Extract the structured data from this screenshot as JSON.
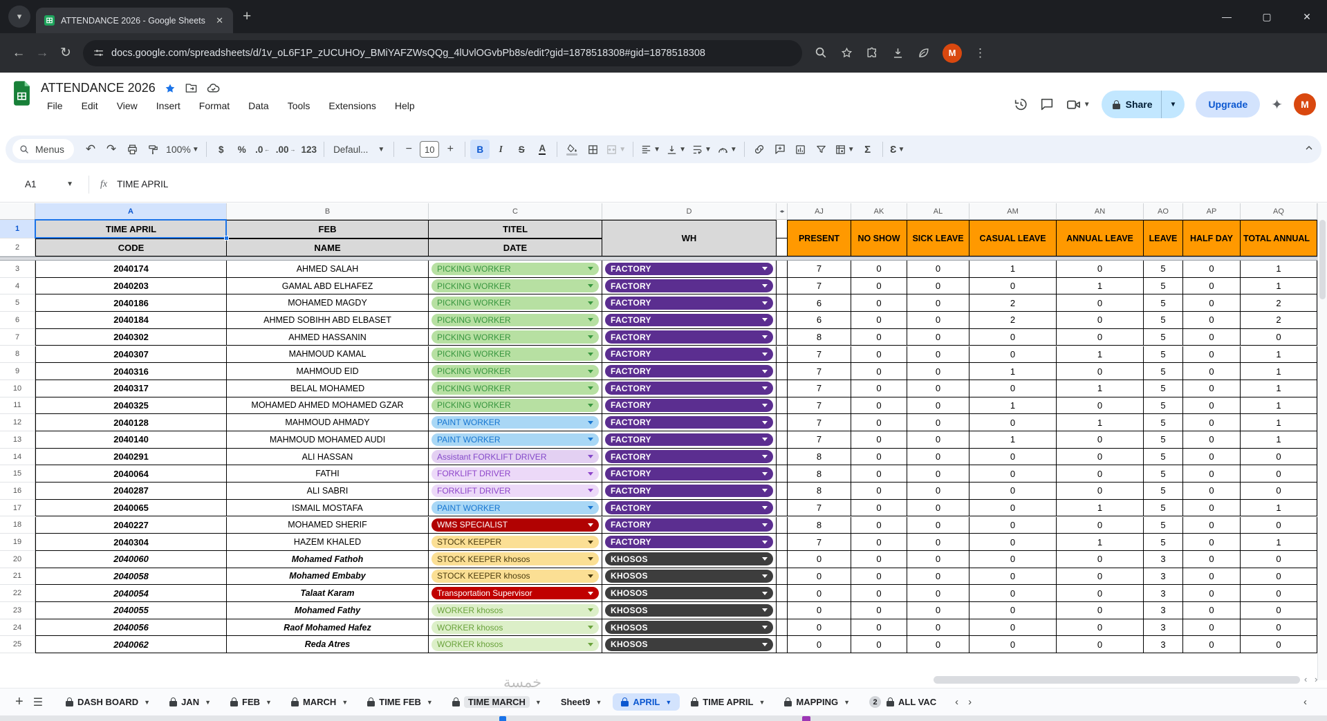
{
  "browser": {
    "tab_title": "ATTENDANCE 2026 - Google Sheets",
    "url": "docs.google.com/spreadsheets/d/1v_oL6F1P_zUCUHOy_BMiYAFZWsQQg_4lUvlOGvbPb8s/edit?gid=1878518308#gid=1878518308"
  },
  "header": {
    "title": "ATTENDANCE 2026",
    "menus": [
      "File",
      "Edit",
      "View",
      "Insert",
      "Format",
      "Data",
      "Tools",
      "Extensions",
      "Help"
    ],
    "share_label": "Share",
    "upgrade_label": "Upgrade",
    "avatar_letter": "M"
  },
  "toolbar": {
    "menus_label": "Menus",
    "zoom": "100%",
    "format_labels": [
      "$",
      "%",
      ".0",
      ".00",
      "123"
    ],
    "font_name": "Defaul...",
    "font_size": "10",
    "bold": "B",
    "italic": "I",
    "strike": "S",
    "textcolor": "A",
    "sigma": "Σ",
    "epsilon": "Ɛ"
  },
  "formula_bar": {
    "cell_ref": "A1",
    "fx_label": "fx",
    "formula": "TIME APRIL"
  },
  "grid": {
    "column_letters": [
      "A",
      "B",
      "C",
      "D",
      "AJ",
      "AK",
      "AL",
      "AM",
      "AN",
      "AO",
      "AP",
      "AQ"
    ],
    "row1": {
      "a": "TIME APRIL",
      "b": "FEB",
      "c": "TITEL",
      "d": "WH"
    },
    "row2": {
      "a": "CODE",
      "b": "NAME",
      "c": "DATE"
    },
    "right_headers": [
      "PRESENT",
      "NO SHOW",
      "SICK LEAVE",
      "CASUAL LEAVE",
      "ANNUAL LEAVE",
      "LEAVE",
      "HALF DAY",
      "TOTAL ANNUAL"
    ],
    "pill_styles": {
      "picking": {
        "bg": "#b7e0a2",
        "fg": "#38963f"
      },
      "paint": {
        "bg": "#a9d7f5",
        "fg": "#1776d1"
      },
      "asst_forklift": {
        "bg": "#e3d0f2",
        "fg": "#8449c9"
      },
      "forklift": {
        "bg": "#ecd9f8",
        "fg": "#8d44c9"
      },
      "wms": {
        "bg": "#b10202",
        "fg": "#ffffff"
      },
      "stock": {
        "bg": "#fbdf94",
        "fg": "#4a3b0e"
      },
      "transport": {
        "bg": "#c00000",
        "fg": "#ffffff"
      },
      "worker": {
        "bg": "#dcefc8",
        "fg": "#6aa23c"
      },
      "factory": {
        "bg": "#5b2e90",
        "fg": "#ffffff"
      },
      "khosos": {
        "bg": "#3d3d3d",
        "fg": "#ffffff"
      }
    },
    "rows": [
      {
        "n": 3,
        "code": "2040174",
        "name": "AHMED SALAH",
        "title": "PICKING WORKER",
        "title_style": "picking",
        "dept": "FACTORY",
        "dept_style": "factory",
        "values": [
          7,
          0,
          0,
          1,
          0,
          5,
          0,
          1
        ],
        "em": false
      },
      {
        "n": 4,
        "code": "2040203",
        "name": "GAMAL ABD ELHAFEZ",
        "title": "PICKING WORKER",
        "title_style": "picking",
        "dept": "FACTORY",
        "dept_style": "factory",
        "values": [
          7,
          0,
          0,
          0,
          1,
          5,
          0,
          1
        ],
        "em": false
      },
      {
        "n": 5,
        "code": "2040186",
        "name": "MOHAMED MAGDY",
        "title": "PICKING WORKER",
        "title_style": "picking",
        "dept": "FACTORY",
        "dept_style": "factory",
        "values": [
          6,
          0,
          0,
          2,
          0,
          5,
          0,
          2
        ],
        "em": false
      },
      {
        "n": 6,
        "code": "2040184",
        "name": "AHMED SOBIHH ABD ELBASET",
        "title": "PICKING WORKER",
        "title_style": "picking",
        "dept": "FACTORY",
        "dept_style": "factory",
        "values": [
          6,
          0,
          0,
          2,
          0,
          5,
          0,
          2
        ],
        "em": false
      },
      {
        "n": 7,
        "code": "2040302",
        "name": "AHMED HASSANIN",
        "title": "PICKING WORKER",
        "title_style": "picking",
        "dept": "FACTORY",
        "dept_style": "factory",
        "values": [
          8,
          0,
          0,
          0,
          0,
          5,
          0,
          0
        ],
        "em": false
      },
      {
        "n": 8,
        "code": "2040307",
        "name": "MAHMOUD KAMAL",
        "title": "PICKING WORKER",
        "title_style": "picking",
        "dept": "FACTORY",
        "dept_style": "factory",
        "values": [
          7,
          0,
          0,
          0,
          1,
          5,
          0,
          1
        ],
        "em": false
      },
      {
        "n": 9,
        "code": "2040316",
        "name": "MAHMOUD EID",
        "title": "PICKING WORKER",
        "title_style": "picking",
        "dept": "FACTORY",
        "dept_style": "factory",
        "values": [
          7,
          0,
          0,
          1,
          0,
          5,
          0,
          1
        ],
        "em": false
      },
      {
        "n": 10,
        "code": "2040317",
        "name": "BELAL MOHAMED",
        "title": "PICKING WORKER",
        "title_style": "picking",
        "dept": "FACTORY",
        "dept_style": "factory",
        "values": [
          7,
          0,
          0,
          0,
          1,
          5,
          0,
          1
        ],
        "em": false
      },
      {
        "n": 11,
        "code": "2040325",
        "name": "MOHAMED AHMED MOHAMED GZAR",
        "title": "PICKING WORKER",
        "title_style": "picking",
        "dept": "FACTORY",
        "dept_style": "factory",
        "values": [
          7,
          0,
          0,
          1,
          0,
          5,
          0,
          1
        ],
        "em": false
      },
      {
        "n": 12,
        "code": "2040128",
        "name": "MAHMOUD AHMADY",
        "title": "PAINT WORKER",
        "title_style": "paint",
        "dept": "FACTORY",
        "dept_style": "factory",
        "values": [
          7,
          0,
          0,
          0,
          1,
          5,
          0,
          1
        ],
        "em": false
      },
      {
        "n": 13,
        "code": "2040140",
        "name": "MAHMOUD MOHAMED AUDI",
        "title": "PAINT WORKER",
        "title_style": "paint",
        "dept": "FACTORY",
        "dept_style": "factory",
        "values": [
          7,
          0,
          0,
          1,
          0,
          5,
          0,
          1
        ],
        "em": false
      },
      {
        "n": 14,
        "code": "2040291",
        "name": "ALI HASSAN",
        "title": "Assistant FORKLIFT DRIVER",
        "title_style": "asst_forklift",
        "dept": "FACTORY",
        "dept_style": "factory",
        "values": [
          8,
          0,
          0,
          0,
          0,
          5,
          0,
          0
        ],
        "em": false
      },
      {
        "n": 15,
        "code": "2040064",
        "name": "FATHI",
        "title": "FORKLIFT DRIVER",
        "title_style": "forklift",
        "dept": "FACTORY",
        "dept_style": "factory",
        "values": [
          8,
          0,
          0,
          0,
          0,
          5,
          0,
          0
        ],
        "em": false
      },
      {
        "n": 16,
        "code": "2040287",
        "name": "ALI SABRI",
        "title": "FORKLIFT DRIVER",
        "title_style": "forklift",
        "dept": "FACTORY",
        "dept_style": "factory",
        "values": [
          8,
          0,
          0,
          0,
          0,
          5,
          0,
          0
        ],
        "em": false
      },
      {
        "n": 17,
        "code": "2040065",
        "name": "ISMAIL MOSTAFA",
        "title": "PAINT WORKER",
        "title_style": "paint",
        "dept": "FACTORY",
        "dept_style": "factory",
        "values": [
          7,
          0,
          0,
          0,
          1,
          5,
          0,
          1
        ],
        "em": false
      },
      {
        "n": 18,
        "code": "2040227",
        "name": "MOHAMED SHERIF",
        "title": "WMS SPECIALIST",
        "title_style": "wms",
        "dept": "FACTORY",
        "dept_style": "factory",
        "values": [
          8,
          0,
          0,
          0,
          0,
          5,
          0,
          0
        ],
        "em": false
      },
      {
        "n": 19,
        "code": "2040304",
        "name": "HAZEM KHALED",
        "title": "STOCK KEEPER",
        "title_style": "stock",
        "dept": "FACTORY",
        "dept_style": "factory",
        "values": [
          7,
          0,
          0,
          0,
          1,
          5,
          0,
          1
        ],
        "em": false
      },
      {
        "n": 20,
        "code": "2040060",
        "name": "Mohamed Fathoh",
        "title": "STOCK KEEPER khosos",
        "title_style": "stock",
        "dept": "KHOSOS",
        "dept_style": "khosos",
        "values": [
          0,
          0,
          0,
          0,
          0,
          3,
          0,
          0
        ],
        "em": true
      },
      {
        "n": 21,
        "code": "2040058",
        "name": "Mohamed Embaby",
        "title": "STOCK KEEPER khosos",
        "title_style": "stock",
        "dept": "KHOSOS",
        "dept_style": "khosos",
        "values": [
          0,
          0,
          0,
          0,
          0,
          3,
          0,
          0
        ],
        "em": true
      },
      {
        "n": 22,
        "code": "2040054",
        "name": "Talaat Karam",
        "title": "Transportation Supervisor",
        "title_style": "transport",
        "dept": "KHOSOS",
        "dept_style": "khosos",
        "values": [
          0,
          0,
          0,
          0,
          0,
          3,
          0,
          0
        ],
        "em": true
      },
      {
        "n": 23,
        "code": "2040055",
        "name": "Mohamed Fathy",
        "title": "WORKER khosos",
        "title_style": "worker",
        "dept": "KHOSOS",
        "dept_style": "khosos",
        "values": [
          0,
          0,
          0,
          0,
          0,
          3,
          0,
          0
        ],
        "em": true
      },
      {
        "n": 24,
        "code": "2040056",
        "name": "Raof Mohamed Hafez",
        "title": "WORKER khosos",
        "title_style": "worker",
        "dept": "KHOSOS",
        "dept_style": "khosos",
        "values": [
          0,
          0,
          0,
          0,
          0,
          3,
          0,
          0
        ],
        "em": true
      },
      {
        "n": 25,
        "code": "2040062",
        "name": "Reda Atres",
        "title": "WORKER khosos",
        "title_style": "worker",
        "dept": "KHOSOS",
        "dept_style": "khosos",
        "values": [
          0,
          0,
          0,
          0,
          0,
          3,
          0,
          0
        ],
        "em": true
      }
    ]
  },
  "tabbar": {
    "tabs": [
      {
        "label": "DASH BOARD",
        "locked": true,
        "active": false
      },
      {
        "label": "JAN",
        "locked": true,
        "active": false
      },
      {
        "label": "FEB",
        "locked": true,
        "active": false
      },
      {
        "label": "MARCH",
        "locked": true,
        "active": false
      },
      {
        "label": "TIME FEB",
        "locked": true,
        "active": false
      },
      {
        "label": "TIME MARCH",
        "locked": true,
        "active": false,
        "muted": true
      },
      {
        "label": "Sheet9",
        "locked": false,
        "active": false
      },
      {
        "label": "APRIL",
        "locked": true,
        "active": true
      },
      {
        "label": "TIME APRIL",
        "locked": true,
        "active": false
      },
      {
        "label": "MAPPING",
        "locked": true,
        "active": false
      },
      {
        "label": "ALL VAC",
        "locked": true,
        "active": false,
        "badge": "2",
        "clipped": true
      }
    ]
  },
  "watermark": "خمسة",
  "colors": {
    "accent_blue": "#0b57d0",
    "selection_blue": "#1a73e8",
    "header_orange": "#ff9900",
    "header_gray": "#d9d9d9",
    "sheets_green": "#188038",
    "avatar_orange": "#d9480f"
  }
}
